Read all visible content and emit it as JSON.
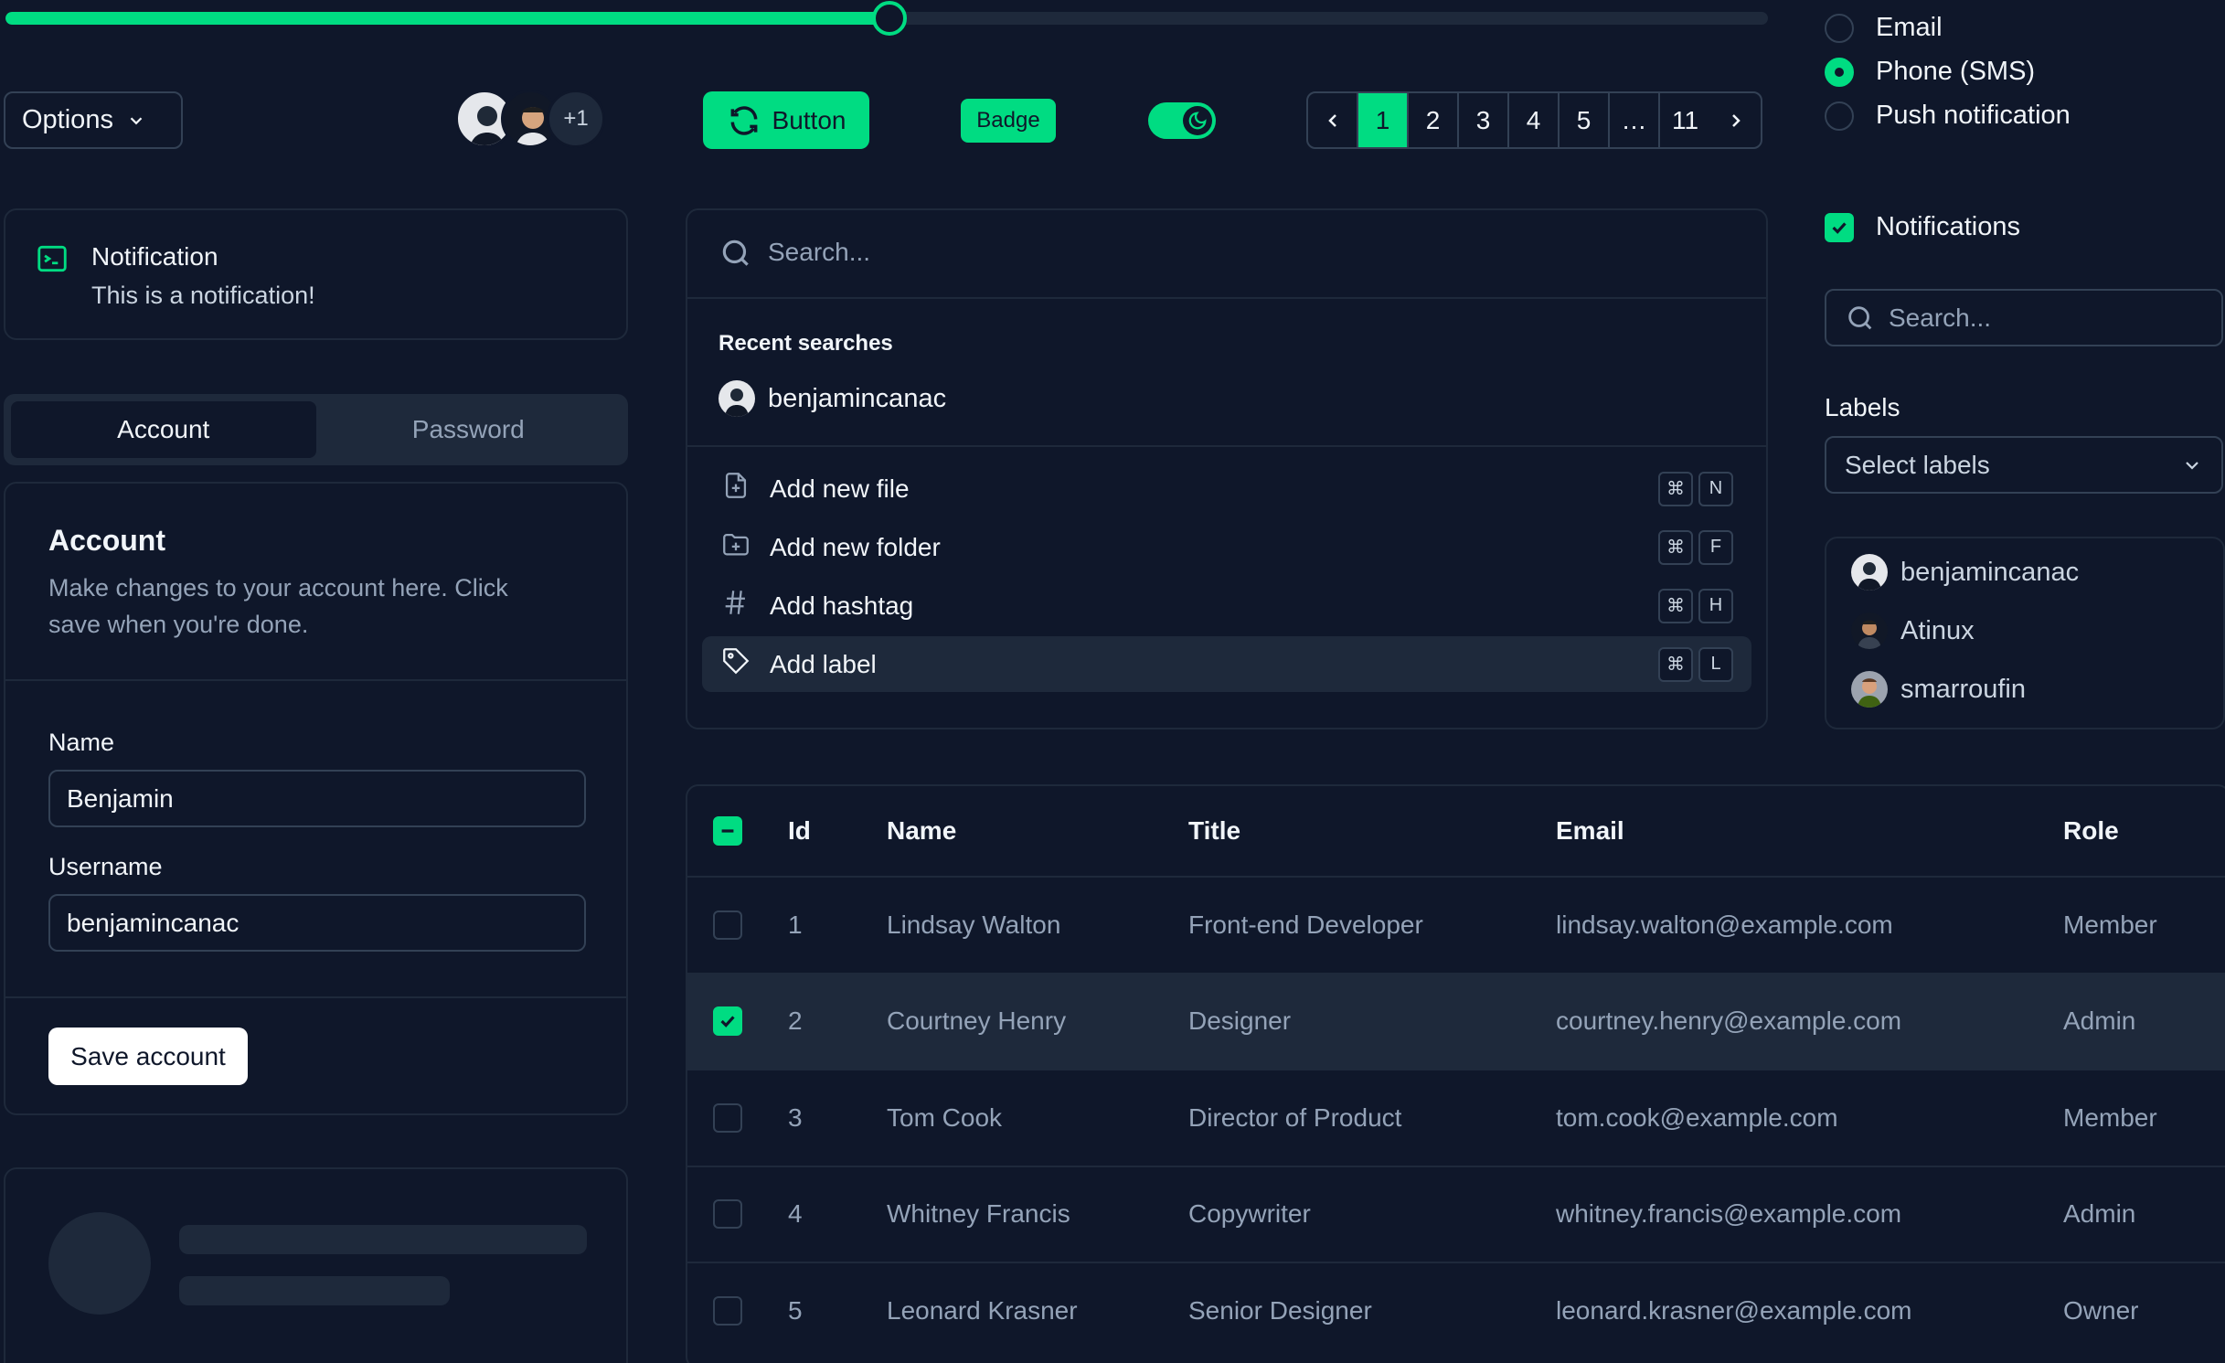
{
  "slider": {
    "value_percent": 50,
    "accent": "#00dc82"
  },
  "options_button": {
    "label": "Options",
    "icon": "chevron-down-icon"
  },
  "avatar_group": {
    "more_label": "+1"
  },
  "primary_button": {
    "label": "Button",
    "icon": "refresh-icon"
  },
  "badge": {
    "label": "Badge"
  },
  "toggle": {
    "on": true,
    "icon": "moon-icon"
  },
  "pagination": {
    "pages": [
      "1",
      "2",
      "3",
      "4",
      "5",
      "…",
      "11"
    ],
    "current": "1"
  },
  "notify_method": {
    "options": [
      "Email",
      "Phone (SMS)",
      "Push notification"
    ],
    "selected": "Phone (SMS)"
  },
  "notifications_checkbox": {
    "label": "Notifications",
    "checked": true
  },
  "right_search": {
    "placeholder": "Search..."
  },
  "labels_select": {
    "label": "Labels",
    "placeholder": "Select labels"
  },
  "user_list": {
    "users": [
      "benjamincanac",
      "Atinux",
      "smarroufin"
    ]
  },
  "notification": {
    "title": "Notification",
    "description": "This is a notification!",
    "icon": "terminal-icon"
  },
  "tabs": {
    "items": [
      "Account",
      "Password"
    ],
    "active": "Account"
  },
  "account_form": {
    "title": "Account",
    "description": "Make changes to your account here. Click save when you're done.",
    "name_label": "Name",
    "name_value": "Benjamin",
    "username_label": "Username",
    "username_value": "benjamincanac",
    "save_label": "Save account"
  },
  "command_palette": {
    "search_placeholder": "Search...",
    "recent_heading": "Recent searches",
    "recent_user": "benjamincanac",
    "items": [
      {
        "label": "Add new file",
        "keys": [
          "⌘",
          "N"
        ],
        "icon": "file-plus-icon"
      },
      {
        "label": "Add new folder",
        "keys": [
          "⌘",
          "F"
        ],
        "icon": "folder-plus-icon"
      },
      {
        "label": "Add hashtag",
        "keys": [
          "⌘",
          "H"
        ],
        "icon": "hashtag-icon"
      },
      {
        "label": "Add label",
        "keys": [
          "⌘",
          "L"
        ],
        "icon": "tag-icon"
      }
    ]
  },
  "table": {
    "columns": [
      "Id",
      "Name",
      "Title",
      "Email",
      "Role"
    ],
    "rows": [
      {
        "id": "1",
        "name": "Lindsay Walton",
        "title": "Front-end Developer",
        "email": "lindsay.walton@example.com",
        "role": "Member",
        "selected": false
      },
      {
        "id": "2",
        "name": "Courtney Henry",
        "title": "Designer",
        "email": "courtney.henry@example.com",
        "role": "Admin",
        "selected": true
      },
      {
        "id": "3",
        "name": "Tom Cook",
        "title": "Director of Product",
        "email": "tom.cook@example.com",
        "role": "Member",
        "selected": false
      },
      {
        "id": "4",
        "name": "Whitney Francis",
        "title": "Copywriter",
        "email": "whitney.francis@example.com",
        "role": "Admin",
        "selected": false
      },
      {
        "id": "5",
        "name": "Leonard Krasner",
        "title": "Senior Designer",
        "email": "leonard.krasner@example.com",
        "role": "Owner",
        "selected": false
      }
    ]
  },
  "colors": {
    "background": "#0f172a",
    "accent": "#00dc82",
    "border": "#1e293b"
  }
}
